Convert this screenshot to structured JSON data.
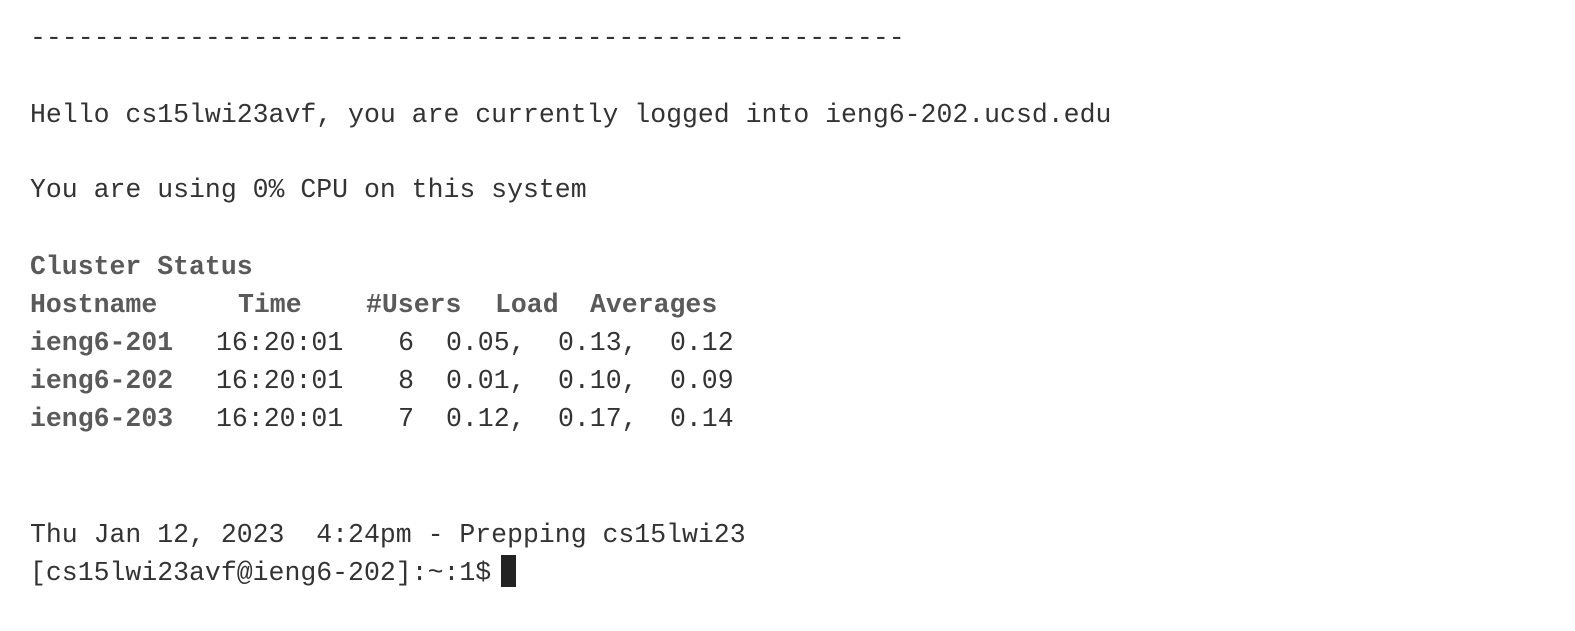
{
  "terminal": {
    "separator": "-------------------------------------------------------",
    "greeting": "Hello cs15lwi23avf, you are currently logged into ieng6-202.ucsd.edu",
    "cpu_usage": "You are using 0% CPU on this system",
    "cluster_status": {
      "title": "Cluster Status",
      "headers": [
        "Hostname",
        "Time",
        "#Users",
        "Load",
        "Averages"
      ],
      "rows": [
        {
          "hostname": "ieng6-201",
          "time": "16:20:01",
          "users": "6",
          "load": [
            "0.05,",
            "0.13,",
            "0.12"
          ]
        },
        {
          "hostname": "ieng6-202",
          "time": "16:20:01",
          "users": "8",
          "load": [
            "0.01,",
            "0.10,",
            "0.09"
          ]
        },
        {
          "hostname": "ieng6-203",
          "time": "16:20:01",
          "users": "7",
          "load": [
            "0.12,",
            "0.17,",
            "0.14"
          ]
        }
      ]
    },
    "date_line": "Thu Jan 12, 2023  4:24pm - Prepping cs15lwi23",
    "prompt": "[cs15lwi23avf@ieng6-202]:~:1$"
  }
}
